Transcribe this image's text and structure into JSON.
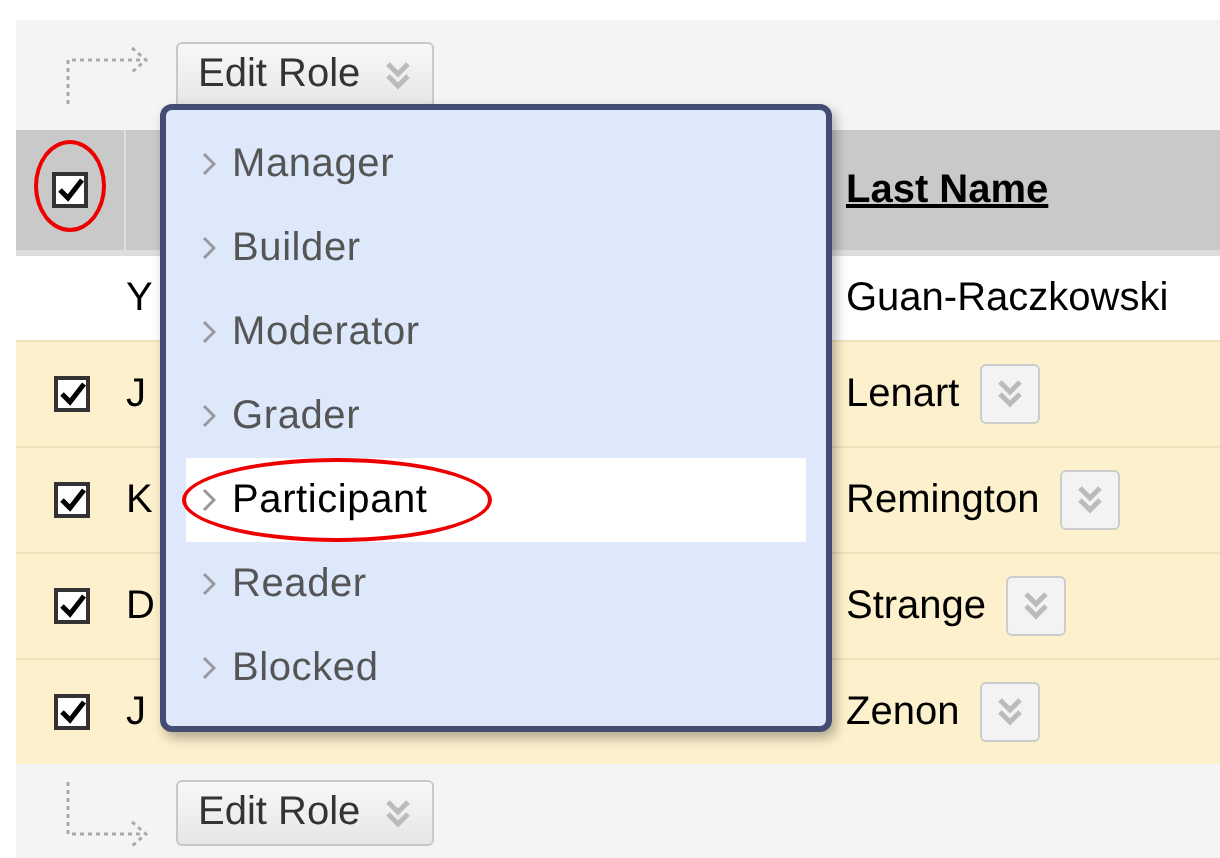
{
  "top_toolbar": {
    "button": "Edit Role"
  },
  "table": {
    "header": {
      "checked": true,
      "circled": true,
      "last_name": "Last Name"
    },
    "rows": [
      {
        "kind": "plain",
        "first_name": "Y",
        "last_name": "Guan-Raczkowski"
      },
      {
        "kind": "selectable",
        "checked": true,
        "first_name": "J",
        "last_name": "Lenart"
      },
      {
        "kind": "selectable",
        "checked": true,
        "first_name": "K",
        "last_name": "Remington"
      },
      {
        "kind": "selectable",
        "checked": true,
        "first_name": "D",
        "last_name": "Strange"
      },
      {
        "kind": "selectable",
        "checked": true,
        "first_name": "J",
        "last_name": "Zenon"
      }
    ]
  },
  "role_menu": {
    "items": [
      {
        "label": "Manager",
        "selected": false,
        "circled": false
      },
      {
        "label": "Builder",
        "selected": false,
        "circled": false
      },
      {
        "label": "Moderator",
        "selected": false,
        "circled": false
      },
      {
        "label": "Grader",
        "selected": false,
        "circled": false
      },
      {
        "label": "Participant",
        "selected": true,
        "circled": true
      },
      {
        "label": "Reader",
        "selected": false,
        "circled": false
      },
      {
        "label": "Blocked",
        "selected": false,
        "circled": false
      }
    ]
  },
  "bottom_toolbar": {
    "button": "Edit Role"
  }
}
